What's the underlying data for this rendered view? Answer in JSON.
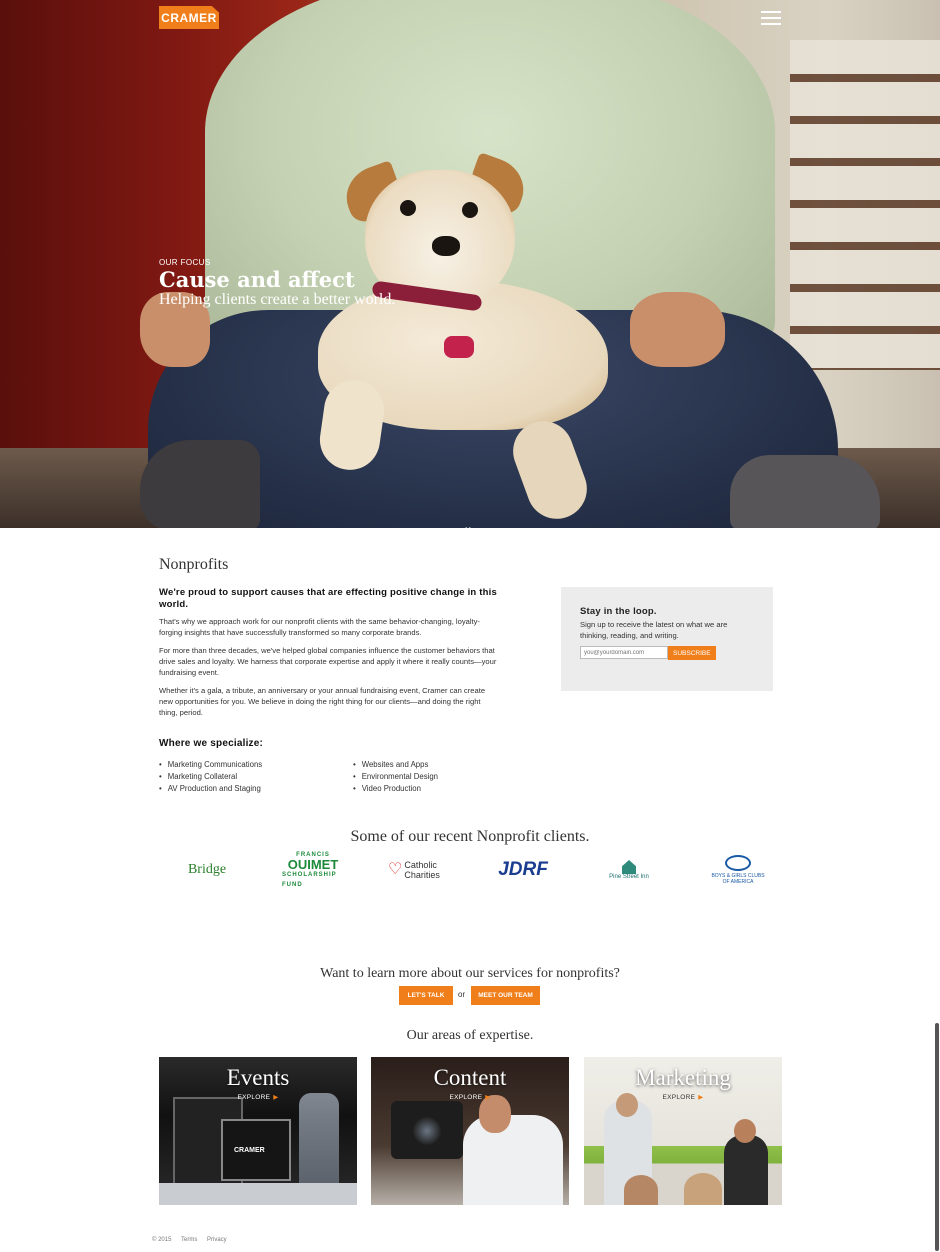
{
  "brand": {
    "logo": "CRAMER",
    "accent": "#f07e1a"
  },
  "hero": {
    "eyebrow": "OUR FOCUS",
    "headline": "Cause and affect",
    "subline": "Helping clients create a better world.",
    "menu_icon": "hamburger-menu-icon",
    "scroll_icon": "chevron-down-icon"
  },
  "nonprofits": {
    "title": "Nonprofits",
    "intro": "We're proud to support causes that are effecting positive change in this world.",
    "paragraphs": [
      "That's why we approach work for our nonprofit clients with the same behavior-changing, loyalty-forging insights that have successfully transformed so many corporate brands.",
      "For more than three decades, we've helped global companies influence the customer behaviors that drive sales and loyalty. We harness that corporate expertise and apply it where it really counts—your fundraising event.",
      "Whether it's a gala, a tribute, an anniversary or your annual fundraising event, Cramer can create new opportunities for you. We believe in doing the right thing for our clients—and doing the right thing, period."
    ],
    "specialize_title": "Where we specialize:",
    "specialize_left": [
      "Marketing Communications",
      "Marketing Collateral",
      "AV Production and Staging"
    ],
    "specialize_right": [
      "Websites and Apps",
      "Environmental Design",
      "Video Production"
    ]
  },
  "signup": {
    "title": "Stay in the loop.",
    "description": "Sign up to receive the latest on what we are thinking, reading, and writing.",
    "placeholder": "you@yourdomain.com",
    "button": "SUBSCRIBE"
  },
  "clients": {
    "title": "Some of our recent Nonprofit clients.",
    "logos": {
      "bridge": "Bridge",
      "ouimet_top": "FRANCIS",
      "ouimet_name": "OUIMET",
      "ouimet_sub": "SCHOLARSHIP FUND",
      "catholic": "Catholic Charities",
      "jdrf": "JDRF",
      "pine": "Pine Street Inn",
      "bgc": "BOYS & GIRLS CLUBS OF AMERICA"
    }
  },
  "cta": {
    "title": "Want to learn more about our services for nonprofits?",
    "talk": "LET'S TALK",
    "or": "or",
    "team": "MEET OUR TEAM"
  },
  "areas": {
    "title": "Our areas of expertise.",
    "explore": "EXPLORE",
    "tiles": [
      "Events",
      "Content",
      "Marketing"
    ],
    "events_case_label": "CRAMER"
  },
  "footer": {
    "copyright": "© 2015",
    "terms": "Terms",
    "privacy": "Privacy"
  }
}
